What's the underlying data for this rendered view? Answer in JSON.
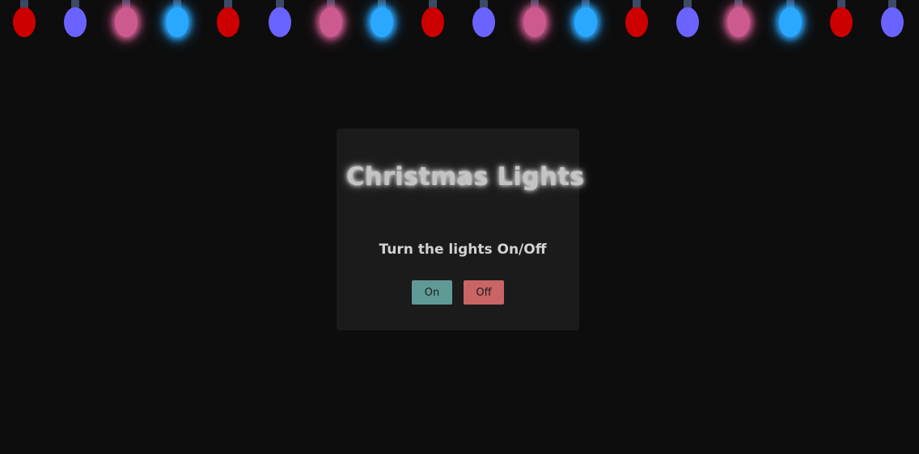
{
  "lights": {
    "bulbs": [
      {
        "color": "#cc0000",
        "glow": false
      },
      {
        "color": "#6b63ff",
        "glow": false
      },
      {
        "color": "#cc5a8f",
        "glow": true
      },
      {
        "color": "#2aa8ff",
        "glow": true
      },
      {
        "color": "#cc0000",
        "glow": false
      },
      {
        "color": "#6b63ff",
        "glow": false
      },
      {
        "color": "#cc5a8f",
        "glow": true
      },
      {
        "color": "#2aa8ff",
        "glow": true
      },
      {
        "color": "#cc0000",
        "glow": false
      },
      {
        "color": "#6b63ff",
        "glow": false
      },
      {
        "color": "#cc5a8f",
        "glow": true
      },
      {
        "color": "#2aa8ff",
        "glow": true
      },
      {
        "color": "#cc0000",
        "glow": false
      },
      {
        "color": "#6b63ff",
        "glow": false
      },
      {
        "color": "#cc5a8f",
        "glow": true
      },
      {
        "color": "#2aa8ff",
        "glow": true
      },
      {
        "color": "#cc0000",
        "glow": false
      },
      {
        "color": "#6b63ff",
        "glow": false
      }
    ]
  },
  "card": {
    "title": "Christmas Lights",
    "subtitle": "Turn the lights On/Off",
    "on_label": "On",
    "off_label": "Off",
    "on_color": "#5f9a97",
    "off_color": "#c96565"
  }
}
